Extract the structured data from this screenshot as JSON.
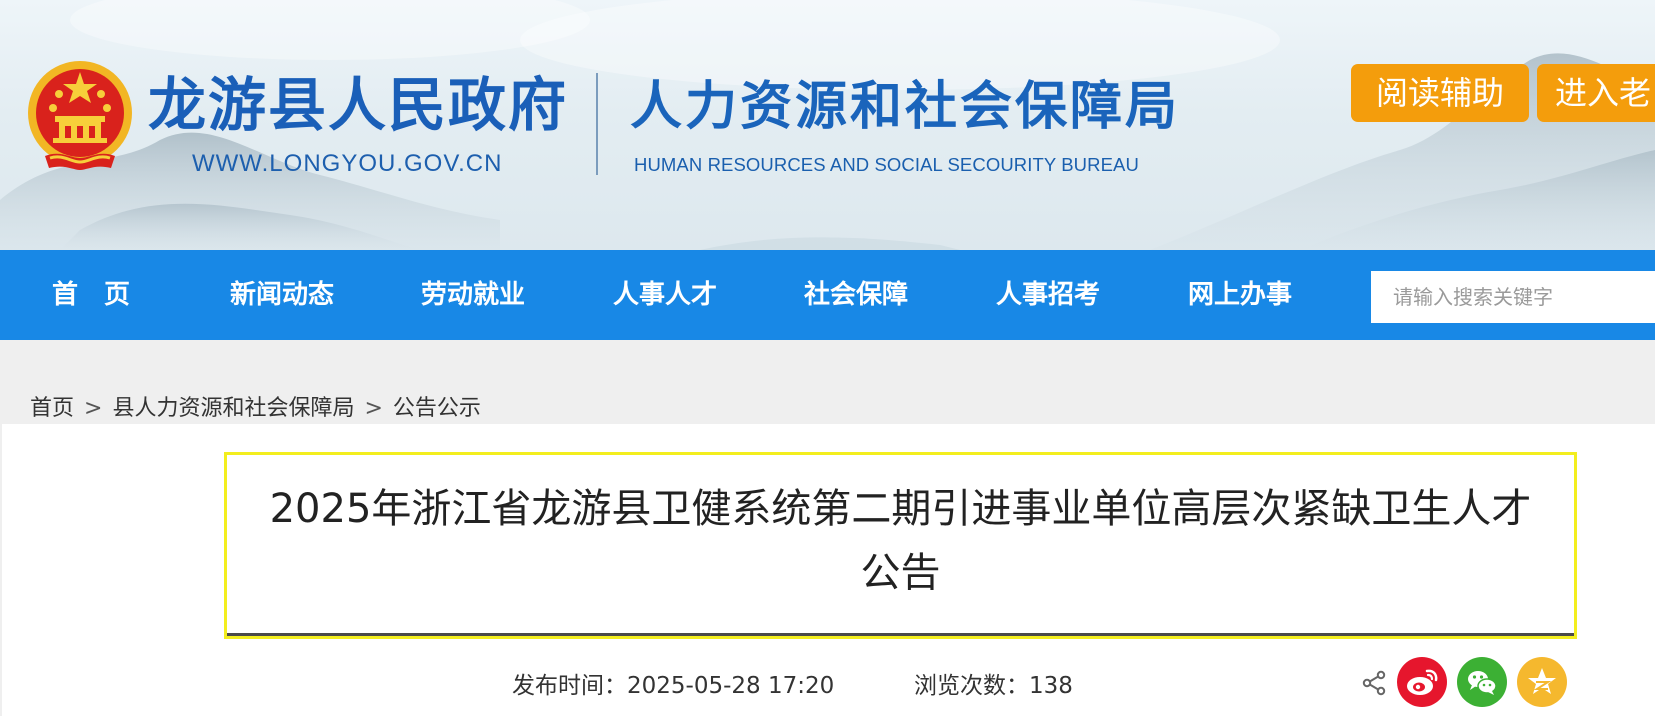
{
  "header": {
    "site_title": "龙游县人民政府",
    "site_url": "WWW.LONGYOU.GOV.CN",
    "bureau_title": "人力资源和社会保障局",
    "bureau_subtitle_en": "HUMAN RESOURCES AND SOCIAL SECOURITY BUREAU",
    "buttons": {
      "reading_assist": "阅读辅助",
      "elder_mode": "进入老"
    }
  },
  "nav": {
    "items": [
      "首　页",
      "新闻动态",
      "劳动就业",
      "人事人才",
      "社会保障",
      "人事招考",
      "网上办事"
    ],
    "search_placeholder": "请输入搜索关键字"
  },
  "breadcrumb": {
    "items": [
      "首页",
      "县人力资源和社会保障局",
      "公告公示"
    ],
    "separator": ">"
  },
  "article": {
    "title_line1": "2025年浙江省龙游县卫健系统第二期引进事业单位高层次紧缺卫生人才",
    "title_line2": "公告",
    "publish_label": "发布时间：",
    "publish_time": "2025-05-28 17:20",
    "views_label": "浏览次数：",
    "views_count": "138"
  },
  "share": {
    "icons": [
      "share-icon",
      "weibo-icon",
      "wechat-icon",
      "qzone-icon"
    ]
  },
  "colors": {
    "nav_bg": "#1888e6",
    "accent_orange": "#f49d0c",
    "title_blue": "#1a5fb8",
    "highlight_border": "#f3ee1e",
    "weibo_red": "#e6162d",
    "wechat_green": "#3cb034",
    "qzone_yellow": "#f5b82e"
  }
}
